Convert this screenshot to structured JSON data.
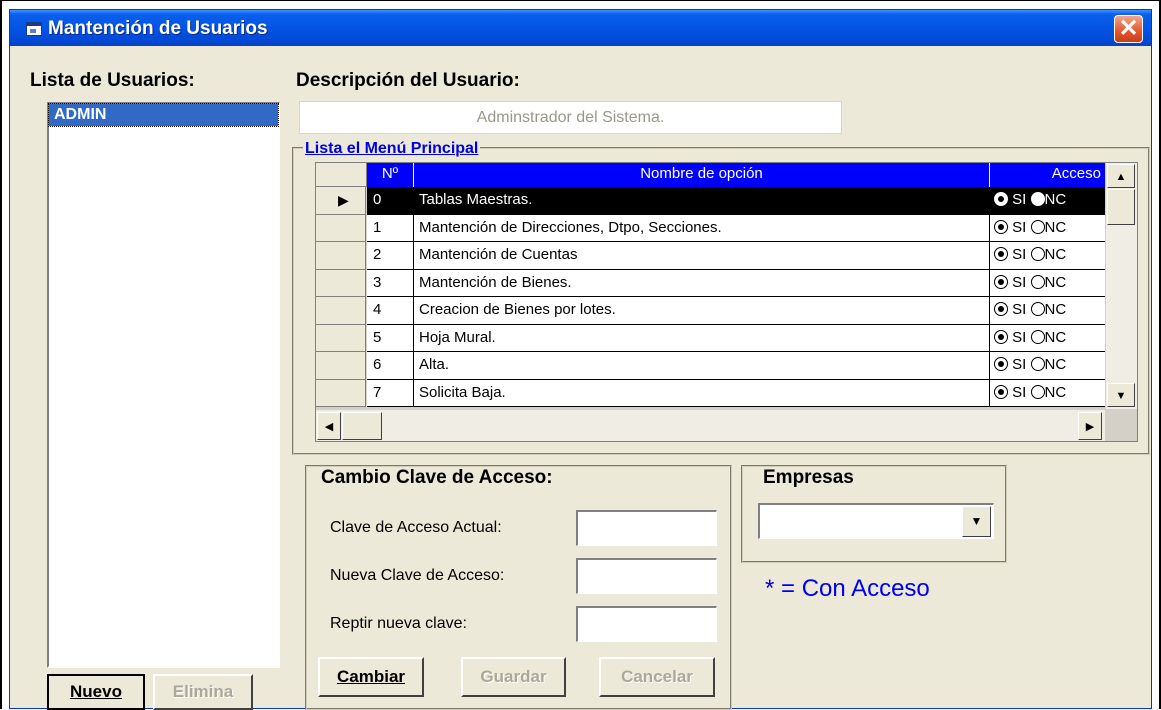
{
  "window": {
    "title": "Mantención de Usuarios",
    "close_glyph": "✕"
  },
  "users": {
    "label": "Lista de Usuarios:",
    "items": [
      "ADMIN"
    ],
    "new_button": "Nuevo",
    "delete_button": "Elimina"
  },
  "description": {
    "label": "Descripción del Usuario:",
    "value": "Adminstrador del Sistema."
  },
  "menu": {
    "group_title": "Lista el Menú Principal",
    "headers": {
      "num": "Nº",
      "name": "Nombre de opción",
      "access": "Acceso"
    },
    "rows": [
      {
        "num": "0",
        "name": "Tablas Maestras.",
        "si": "SI",
        "no": "NC",
        "access": "SI",
        "selected": true
      },
      {
        "num": "1",
        "name": "Mantención de Direcciones, Dtpo, Secciones.",
        "si": "SI",
        "no": "NC",
        "access": "SI"
      },
      {
        "num": "2",
        "name": "Mantención de Cuentas",
        "si": "SI",
        "no": "NC",
        "access": "SI"
      },
      {
        "num": "3",
        "name": "Mantención de Bienes.",
        "si": "SI",
        "no": "NC",
        "access": "SI"
      },
      {
        "num": "4",
        "name": "Creacion de Bienes por lotes.",
        "si": "SI",
        "no": "NC",
        "access": "SI"
      },
      {
        "num": "5",
        "name": "Hoja Mural.",
        "si": "SI",
        "no": "NC",
        "access": "SI"
      },
      {
        "num": "6",
        "name": "Alta.",
        "si": "SI",
        "no": "NC",
        "access": "SI"
      },
      {
        "num": "7",
        "name": "Solicita Baja.",
        "si": "SI",
        "no": "NC",
        "access": "SI"
      }
    ],
    "selected_row_marker": "▶"
  },
  "password": {
    "title": "Cambio Clave de Acceso:",
    "current_label": "Clave de Acceso Actual:",
    "new_label": "Nueva Clave de Acceso:",
    "repeat_label": "Reptir nueva clave:",
    "current_value": "",
    "new_value": "",
    "repeat_value": "",
    "change_button": "Cambiar",
    "save_button": "Guardar",
    "cancel_button": "Cancelar"
  },
  "companies": {
    "title": "Empresas",
    "selected": ""
  },
  "legend": "* = Con Acceso",
  "colors": {
    "title_bar": "#0454e4",
    "grid_header": "#0000ff",
    "list_selection": "#316ac5",
    "legend_text": "#0000ee",
    "group_title": "#0000e0"
  }
}
